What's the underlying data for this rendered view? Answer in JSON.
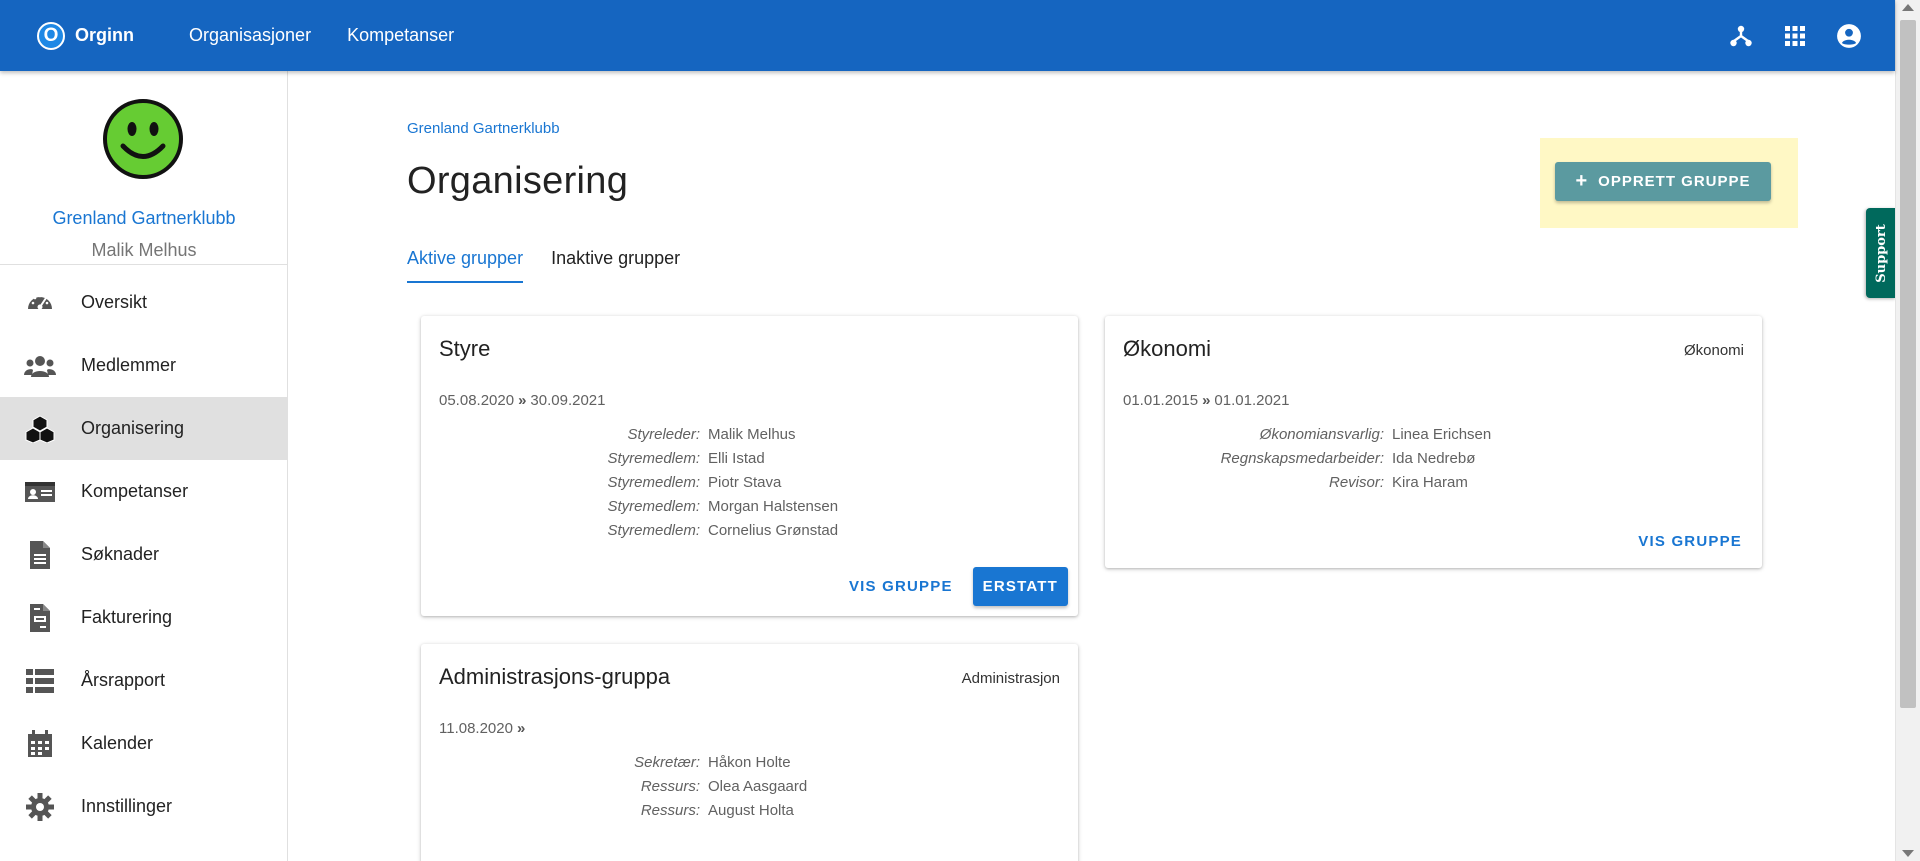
{
  "topbar": {
    "brand_logo_letter": "O",
    "brand_name": "Orginn",
    "nav": [
      "Organisasjoner",
      "Kompetanser"
    ],
    "bg_color": "#1565c0"
  },
  "sidebar": {
    "org_name": "Grenland Gartnerklubb",
    "user_name": "Malik Melhus",
    "items": [
      {
        "label": "Oversikt",
        "icon": "dashboard-gauge-icon"
      },
      {
        "label": "Medlemmer",
        "icon": "users-icon"
      },
      {
        "label": "Organisering",
        "icon": "cubes-icon",
        "active": true
      },
      {
        "label": "Kompetanser",
        "icon": "id-card-icon"
      },
      {
        "label": "Søknader",
        "icon": "document-icon"
      },
      {
        "label": "Fakturering",
        "icon": "invoice-icon"
      },
      {
        "label": "Årsrapport",
        "icon": "list-icon"
      },
      {
        "label": "Kalender",
        "icon": "calendar-icon"
      },
      {
        "label": "Innstillinger",
        "icon": "gear-icon"
      }
    ]
  },
  "main": {
    "breadcrumb": "Grenland Gartnerklubb",
    "title": "Organisering",
    "create_button": "OPPRETT GRUPPE",
    "tabs": [
      {
        "label": "Aktive grupper",
        "active": true
      },
      {
        "label": "Inaktive grupper",
        "active": false
      }
    ],
    "support_label": "Support"
  },
  "cards": [
    {
      "title": "Styre",
      "type": "",
      "date_from": "05.08.2020",
      "date_to": "30.09.2021",
      "members": [
        {
          "role": "Styreleder:",
          "name": "Malik Melhus"
        },
        {
          "role": "Styremedlem:",
          "name": "Elli Istad"
        },
        {
          "role": "Styremedlem:",
          "name": "Piotr Stava"
        },
        {
          "role": "Styremedlem:",
          "name": "Morgan Halstensen"
        },
        {
          "role": "Styremedlem:",
          "name": "Cornelius Grønstad"
        }
      ],
      "view_button": "VIS GRUPPE",
      "replace_button": "ERSTATT"
    },
    {
      "title": "Økonomi",
      "type": "Økonomi",
      "date_from": "01.01.2015",
      "date_to": "01.01.2021",
      "members": [
        {
          "role": "Økonomiansvarlig:",
          "name": "Linea Erichsen"
        },
        {
          "role": "Regnskapsmedarbeider:",
          "name": "Ida Nedrebø"
        },
        {
          "role": "Revisor:",
          "name": "Kira Haram"
        }
      ],
      "view_button": "VIS GRUPPE"
    },
    {
      "title": "Administrasjons-gruppa",
      "type": "Administrasjon",
      "date_from": "11.08.2020",
      "date_to": "",
      "members": [
        {
          "role": "Sekretær:",
          "name": "Håkon Holte"
        },
        {
          "role": "Ressurs:",
          "name": "Olea Aasgaard"
        },
        {
          "role": "Ressurs:",
          "name": "August Holta"
        }
      ]
    }
  ]
}
